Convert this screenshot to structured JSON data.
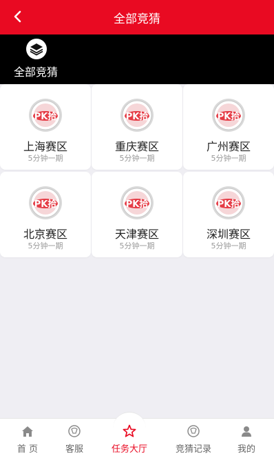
{
  "header": {
    "title": "全部竞猜"
  },
  "category": {
    "label": "全部竞猜"
  },
  "zones": [
    {
      "name": "上海赛区",
      "interval": "5分钟一期",
      "logo_text": "PK拾"
    },
    {
      "name": "重庆赛区",
      "interval": "5分钟一期",
      "logo_text": "PK拾"
    },
    {
      "name": "广州赛区",
      "interval": "5分钟一期",
      "logo_text": "PK拾"
    },
    {
      "name": "北京赛区",
      "interval": "5分钟一期",
      "logo_text": "PK拾"
    },
    {
      "name": "天津赛区",
      "interval": "5分钟一期",
      "logo_text": "PK拾"
    },
    {
      "name": "深圳赛区",
      "interval": "5分钟一期",
      "logo_text": "PK拾"
    }
  ],
  "tabbar": {
    "items": [
      {
        "label": "首 页",
        "icon": "home-icon"
      },
      {
        "label": "客服",
        "icon": "customer-service-icon"
      },
      {
        "label": "任务大厅",
        "icon": "star-icon",
        "active": true
      },
      {
        "label": "竞猜记录",
        "icon": "record-icon"
      },
      {
        "label": "我的",
        "icon": "user-icon"
      }
    ]
  },
  "colors": {
    "brand": "#e90a22",
    "category_bar": "#000000",
    "background": "#efeef3"
  }
}
